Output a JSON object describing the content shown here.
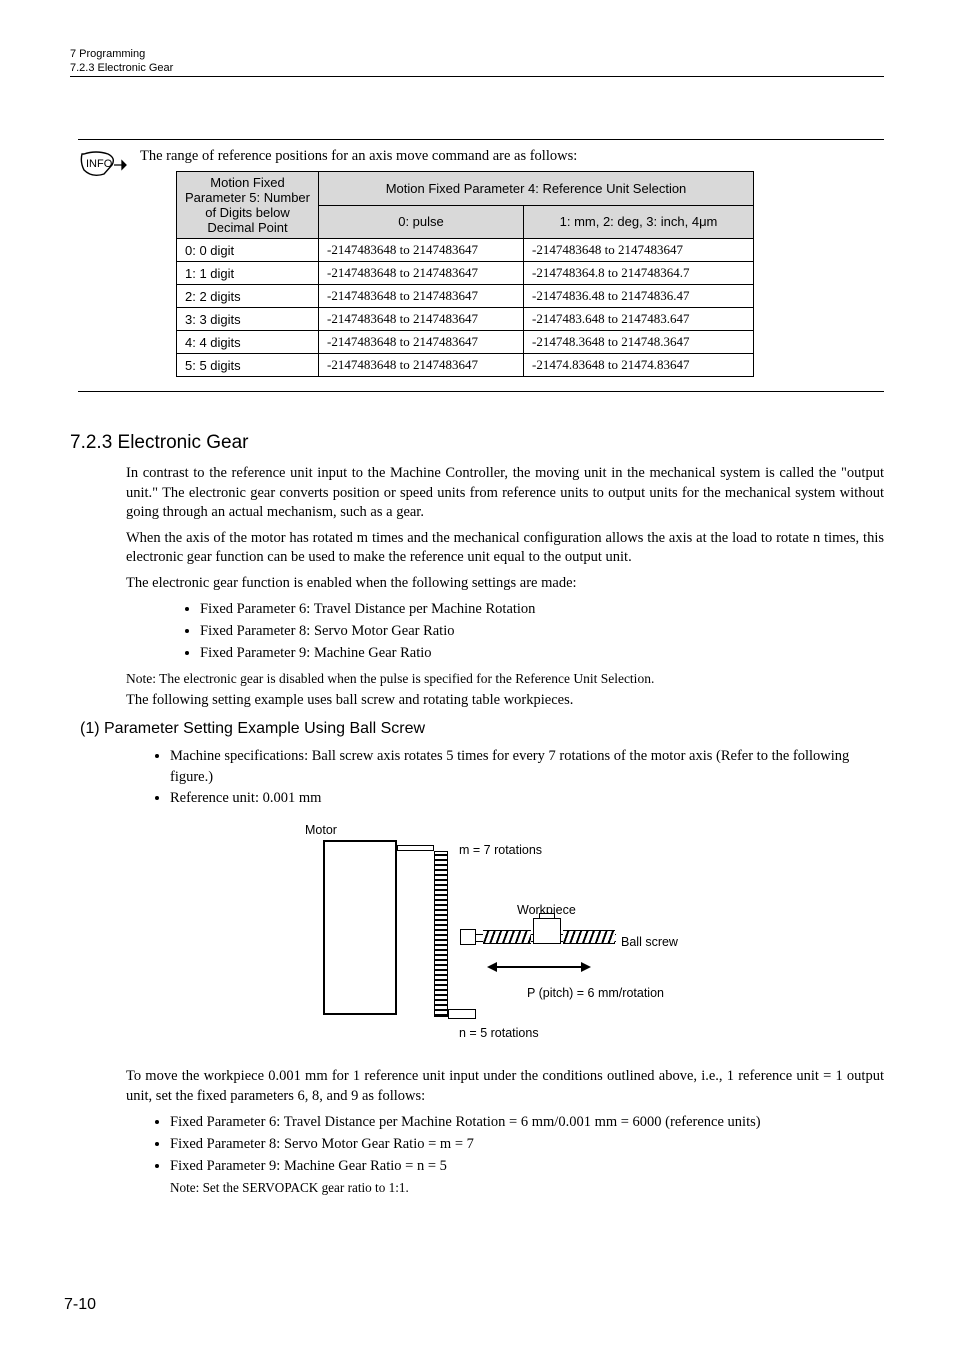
{
  "header": {
    "chapter": "7  Programming",
    "section_small": "7.2.3  Electronic Gear"
  },
  "info_box": {
    "intro": "The range of reference positions for an axis move command are as follows:",
    "table": {
      "head_left": "Motion Fixed Parameter 5: Number of Digits below Decimal Point",
      "head_right": "Motion Fixed Parameter 4: Reference Unit Selection",
      "sub_left": "0: pulse",
      "sub_right": "1: mm, 2: deg, 3: inch, 4μm",
      "rows": [
        {
          "d": "0: 0 digit",
          "p": "-2147483648 to 2147483647",
          "u": "-2147483648 to 2147483647"
        },
        {
          "d": "1: 1 digit",
          "p": "-2147483648 to 2147483647",
          "u": "-214748364.8 to 214748364.7"
        },
        {
          "d": "2: 2 digits",
          "p": "-2147483648 to 2147483647",
          "u": "-21474836.48 to 21474836.47"
        },
        {
          "d": "3: 3 digits",
          "p": "-2147483648 to 2147483647",
          "u": "-2147483.648 to 2147483.647"
        },
        {
          "d": "4: 4 digits",
          "p": "-2147483648 to 2147483647",
          "u": "-214748.3648 to 214748.3647"
        },
        {
          "d": "5: 5 digits",
          "p": "-2147483648 to 2147483647",
          "u": "-21474.83648 to 21474.83647"
        }
      ]
    }
  },
  "section": {
    "heading": "7.2.3  Electronic Gear",
    "p1": "In contrast to the reference unit input to the Machine Controller, the moving unit in the mechanical system is called the \"output unit.\" The electronic gear converts position or speed units from reference units to output units for the mechanical system without going through an actual mechanism, such as a gear.",
    "p2": "When the axis of the motor has rotated m times and the mechanical configuration allows the axis at the load to rotate n times, this electronic gear function can be used to make the reference unit equal to the output unit.",
    "p3": "The electronic gear function is enabled when the following settings are made:",
    "bullets": [
      "Fixed Parameter 6: Travel Distance per Machine Rotation",
      "Fixed Parameter 8: Servo Motor Gear Ratio",
      "Fixed Parameter 9: Machine Gear Ratio"
    ],
    "note": "Note:  The electronic gear is disabled when the pulse is specified for the Reference Unit Selection.",
    "p4": "The following setting example uses ball screw and rotating table workpieces."
  },
  "subsection": {
    "heading": "(1) Parameter Setting Example Using Ball Screw",
    "bullets": [
      "Machine specifications: Ball screw axis rotates 5 times for every 7 rotations of the motor axis (Refer to the following figure.)",
      "Reference unit: 0.001 mm"
    ]
  },
  "diagram": {
    "motor": "Motor",
    "m7": "m = 7 rotations",
    "workpiece": "Workpiece",
    "ballscrew": "Ball screw",
    "pitch": "P (pitch) = 6 mm/rotation",
    "n5": "n = 5 rotations"
  },
  "closing": {
    "p": "To move the workpiece 0.001 mm for 1 reference unit input under the conditions outlined above, i.e., 1 reference unit = 1 output unit, set the fixed parameters 6, 8, and 9 as follows:",
    "bullets": [
      "Fixed Parameter 6: Travel Distance per Machine Rotation = 6 mm/0.001 mm = 6000 (reference units)",
      "Fixed Parameter 8: Servo Motor Gear Ratio = m = 7",
      "Fixed Parameter 9: Machine Gear Ratio = n = 5"
    ],
    "note": "Note:  Set the SERVOPACK gear ratio to 1:1."
  },
  "page_number": "7-10"
}
